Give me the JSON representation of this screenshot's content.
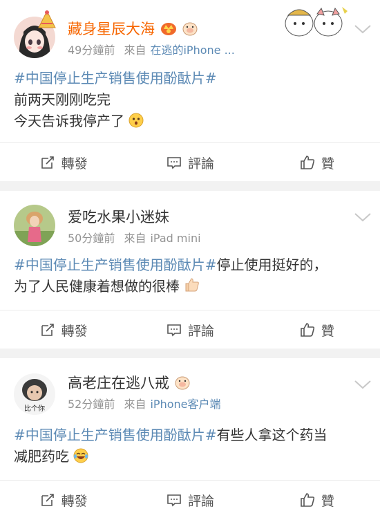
{
  "posts": [
    {
      "username": "藏身星辰大海",
      "time": "49分鐘前",
      "from_label": "來自",
      "source": "在逃的iPhone ...",
      "hashtag": "#中国停止生产销售使用酚酞片#",
      "lines": [
        "前两天刚刚吃完",
        "今天告诉我停产了"
      ],
      "repost": "轉發",
      "comment": "評論",
      "like": "贊"
    },
    {
      "username": "爱吃水果小迷妹",
      "time": "50分鐘前",
      "from_label": "來自",
      "source": "iPad mini",
      "hashtag": "#中国停止生产销售使用酚酞片#",
      "text_after_tag": "停止使用挺好的，",
      "line2": "为了人民健康着想做的很棒",
      "repost": "轉發",
      "comment": "評論",
      "like": "贊"
    },
    {
      "username": "高老庄在逃八戒",
      "avatar_caption": "比个你",
      "time": "52分鐘前",
      "from_label": "來自",
      "source": "iPhone客户端",
      "hashtag": "#中国停止生产销售使用酚酞片#",
      "text_after_tag": "有些人拿这个药当",
      "line2": "减肥药吃",
      "repost": "轉發",
      "comment": "評論",
      "like": "贊"
    }
  ],
  "colors": {
    "link": "#5b89b4",
    "vip_name": "#f76600",
    "meta": "#939393"
  }
}
